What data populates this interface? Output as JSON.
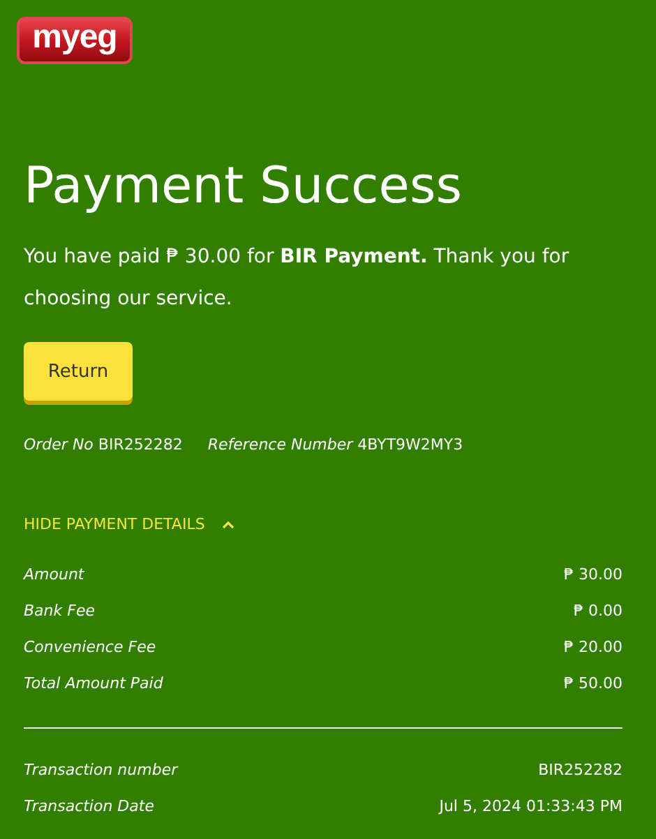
{
  "logo": {
    "text": "myeg"
  },
  "title": "Payment Success",
  "message": "You have paid ₱ 30.00 for **BIR Payment.** Thank you for choosing our service.",
  "return_button": "Return",
  "order": {
    "order_label": "Order No",
    "order_value": "BIR252282",
    "reference_label": "Reference Number",
    "reference_value": "4BYT9W2MY3"
  },
  "details_toggle": {
    "label": "HIDE PAYMENT DETAILS",
    "expanded": true
  },
  "payment_rows": [
    {
      "label": "Amount",
      "value": "₱ 30.00"
    },
    {
      "label": "Bank Fee",
      "value": "₱ 0.00"
    },
    {
      "label": "Convenience Fee",
      "value": "₱ 20.00"
    },
    {
      "label": "Total Amount Paid",
      "value": "₱ 50.00"
    }
  ],
  "transaction_rows": [
    {
      "label": "Transaction number",
      "value": "BIR252282"
    },
    {
      "label": "Transaction Date",
      "value": "Jul 5, 2024 01:33:43 PM"
    }
  ]
}
